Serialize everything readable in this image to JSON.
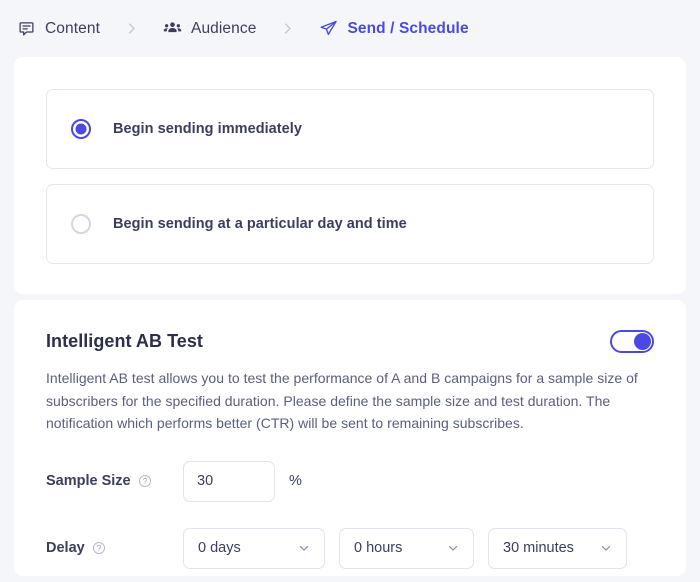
{
  "breadcrumb": {
    "steps": [
      {
        "label": "Content",
        "icon": "message-bubble-icon",
        "active": false
      },
      {
        "label": "Audience",
        "icon": "people-group-icon",
        "active": false
      },
      {
        "label": "Send / Schedule",
        "icon": "paper-plane-icon",
        "active": true
      }
    ],
    "separator_icon": "chevron-right-icon"
  },
  "schedule": {
    "options": [
      {
        "label": "Begin sending immediately",
        "selected": true
      },
      {
        "label": "Begin sending at a particular day and time",
        "selected": false
      }
    ]
  },
  "ab_test": {
    "title": "Intelligent AB Test",
    "toggle_state": "on",
    "description": "Intelligent AB test allows you to test the performance of A and B campaigns for a sample size of subscribers for the specified duration. Please define the sample size and test duration. The notification which performs better (CTR) will be sent to remaining subscribes.",
    "sample_size": {
      "label": "Sample Size",
      "help_icon": "question-circle-icon",
      "value": "30",
      "placeholder": "",
      "unit": "%"
    },
    "delay": {
      "label": "Delay",
      "help_icon": "question-circle-icon",
      "days": {
        "value": "0 days",
        "chevron": "chevron-down-icon"
      },
      "hours": {
        "value": "0 hours",
        "chevron": "chevron-down-icon"
      },
      "minutes": {
        "value": "30 minutes",
        "chevron": "chevron-down-icon"
      }
    }
  },
  "colors": {
    "accent": "#4b49e4",
    "page_bg": "#f5f6fa",
    "card_bg": "#ffffff",
    "text": "#3b3f5c",
    "muted": "#5a5f7d",
    "border": "#e6e7ee"
  }
}
